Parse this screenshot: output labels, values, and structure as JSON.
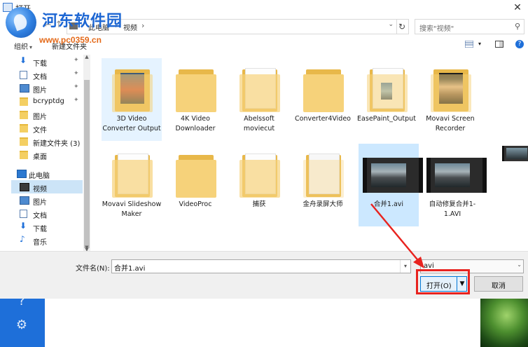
{
  "window": {
    "title": "打开",
    "close_glyph": "✕"
  },
  "watermark": {
    "site_name": "河东软件园",
    "url": "www.pc0359.cn"
  },
  "address": {
    "crumbs": [
      "此电脑",
      "视频"
    ],
    "separator": "›",
    "search_placeholder": "搜索\"视频\""
  },
  "toolbar": {
    "organize": "组织",
    "new_folder": "新建文件夹"
  },
  "nav": {
    "items": [
      {
        "label": "下载",
        "icon": "download-icon",
        "pinned": true
      },
      {
        "label": "文档",
        "icon": "document-icon",
        "pinned": true
      },
      {
        "label": "图片",
        "icon": "picture-icon",
        "pinned": true
      },
      {
        "label": "bcryptdg",
        "icon": "folder-icon",
        "pinned": true
      },
      {
        "label": "图片",
        "icon": "folder-icon",
        "pinned": false
      },
      {
        "label": "文件",
        "icon": "folder-icon",
        "pinned": false
      },
      {
        "label": "新建文件夹 (3)",
        "icon": "folder-icon",
        "pinned": false
      },
      {
        "label": "桌面",
        "icon": "folder-icon",
        "pinned": false
      },
      {
        "label": "此电脑",
        "icon": "computer-icon",
        "pinned": false
      },
      {
        "label": "视频",
        "icon": "video-folder-icon",
        "pinned": false,
        "selected": true
      },
      {
        "label": "图片",
        "icon": "picture-icon",
        "pinned": false
      },
      {
        "label": "文档",
        "icon": "document-icon",
        "pinned": false
      },
      {
        "label": "下载",
        "icon": "download-icon",
        "pinned": false
      },
      {
        "label": "音乐",
        "icon": "music-icon",
        "pinned": false
      }
    ],
    "pin_glyph": "📌"
  },
  "files": [
    {
      "label": "3D Video Converter Output",
      "kind": "folder-thumb",
      "state": "hover"
    },
    {
      "label": "4K Video Downloader",
      "kind": "folder"
    },
    {
      "label": "Abelssoft moviecut",
      "kind": "folder-docs"
    },
    {
      "label": "Converter4Video",
      "kind": "folder"
    },
    {
      "label": "EasePaint_Output",
      "kind": "folder-thumb"
    },
    {
      "label": "Movavi Screen Recorder",
      "kind": "folder-photo"
    },
    {
      "label": "Movavi Slideshow Maker",
      "kind": "folder-docs"
    },
    {
      "label": "VideoProc",
      "kind": "folder"
    },
    {
      "label": "捕获",
      "kind": "folder-docs"
    },
    {
      "label": "金舟录屏大师",
      "kind": "folder-blank"
    },
    {
      "label": "合并1.avi",
      "kind": "video",
      "state": "selected"
    },
    {
      "label": "自动修复合并1-1.AVI",
      "kind": "video"
    }
  ],
  "bottom": {
    "filename_label": "文件名(N):",
    "filename_value": "合并1.avi",
    "filetype_value": "avi",
    "open_label": "打开(O)",
    "cancel_label": "取消"
  },
  "accent_colors": {
    "highlight": "#e8231f",
    "selection": "#cce8ff",
    "sidebar": "#1e6fd9"
  },
  "background_app": {
    "icons": [
      "help-icon",
      "settings-icon"
    ]
  }
}
